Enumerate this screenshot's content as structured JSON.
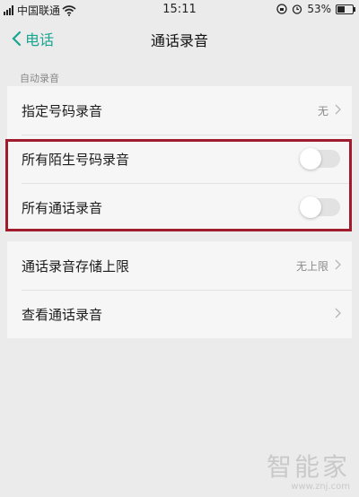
{
  "status_bar": {
    "carrier": "中国联通",
    "time": "15:11",
    "battery": "53%",
    "battery_level": 0.53
  },
  "nav": {
    "back_label": "电话",
    "title": "通话录音"
  },
  "section": {
    "label": "自动录音"
  },
  "rows": [
    {
      "label": "指定号码录音",
      "value": "无"
    },
    {
      "label": "所有陌生号码录音",
      "toggle_on": false
    },
    {
      "label": "所有通话录音",
      "toggle_on": false
    }
  ],
  "rows2": [
    {
      "label": "通话录音存储上限",
      "value": "无上限"
    },
    {
      "label": "查看通话录音",
      "value": ""
    }
  ],
  "watermark": {
    "title": "智能家",
    "url": "www.znj.com"
  },
  "colors": {
    "accent": "#1aa58f",
    "highlight": "#a01c2c"
  }
}
